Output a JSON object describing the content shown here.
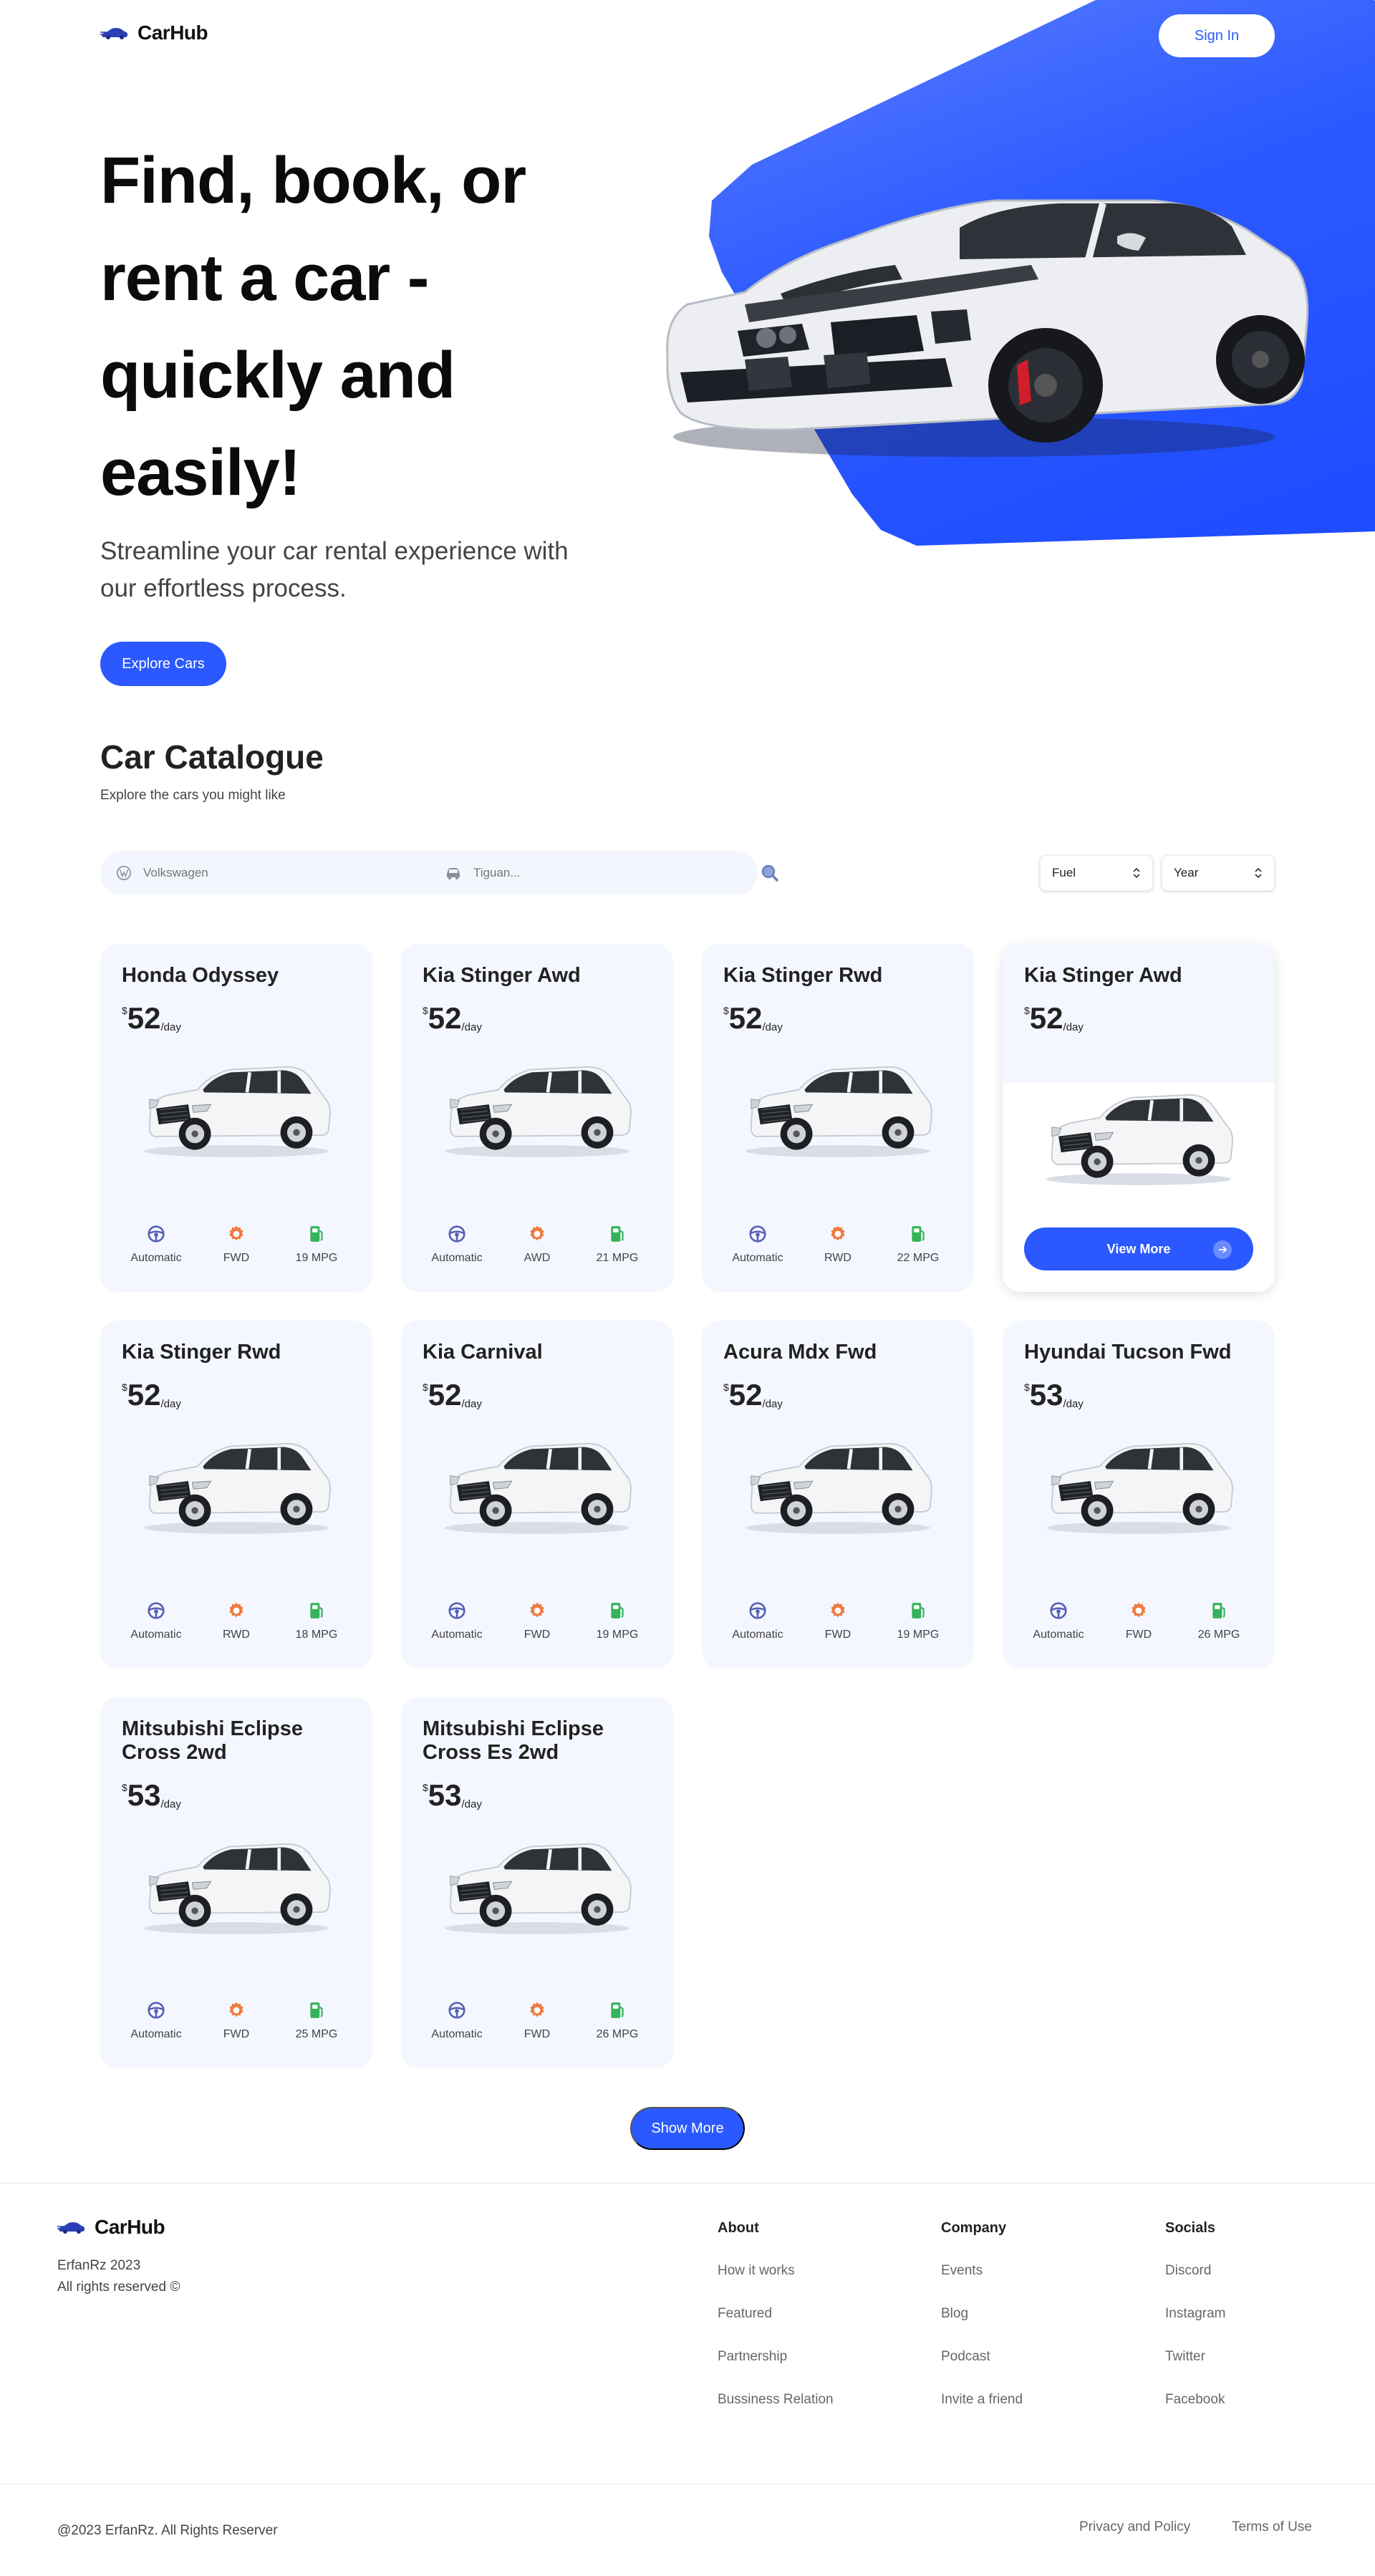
{
  "nav": {
    "logo_text": "CarHub",
    "signin_label": "Sign In"
  },
  "hero": {
    "title": "Find, book, or rent a car - quickly and easily!",
    "subtitle": "Streamline your car rental experience with our effortless process.",
    "cta_label": "Explore Cars"
  },
  "catalogue": {
    "title": "Car Catalogue",
    "subtitle": "Explore the cars you might like",
    "manufacturer_placeholder": "Volkswagen",
    "model_placeholder": "Tiguan...",
    "fuel_label": "Fuel",
    "year_label": "Year"
  },
  "cars": [
    {
      "name": "Honda Odyssey",
      "currency": "$",
      "price": "52",
      "per": "/day",
      "transmission": "Automatic",
      "drive": "FWD",
      "mpg": "19 MPG"
    },
    {
      "name": "Kia Stinger Awd",
      "currency": "$",
      "price": "52",
      "per": "/day",
      "transmission": "Automatic",
      "drive": "AWD",
      "mpg": "21 MPG"
    },
    {
      "name": "Kia Stinger Rwd",
      "currency": "$",
      "price": "52",
      "per": "/day",
      "transmission": "Automatic",
      "drive": "RWD",
      "mpg": "22 MPG"
    },
    {
      "name": "Kia Stinger Awd",
      "currency": "$",
      "price": "52",
      "per": "/day",
      "view_more": "View More"
    },
    {
      "name": "Kia Stinger Rwd",
      "currency": "$",
      "price": "52",
      "per": "/day",
      "transmission": "Automatic",
      "drive": "RWD",
      "mpg": "18 MPG"
    },
    {
      "name": "Kia Carnival",
      "currency": "$",
      "price": "52",
      "per": "/day",
      "transmission": "Automatic",
      "drive": "FWD",
      "mpg": "19 MPG"
    },
    {
      "name": "Acura Mdx Fwd",
      "currency": "$",
      "price": "52",
      "per": "/day",
      "transmission": "Automatic",
      "drive": "FWD",
      "mpg": "19 MPG"
    },
    {
      "name": "Hyundai Tucson Fwd",
      "currency": "$",
      "price": "53",
      "per": "/day",
      "transmission": "Automatic",
      "drive": "FWD",
      "mpg": "26 MPG"
    },
    {
      "name": "Mitsubishi Eclipse Cross 2wd",
      "currency": "$",
      "price": "53",
      "per": "/day",
      "transmission": "Automatic",
      "drive": "FWD",
      "mpg": "25 MPG"
    },
    {
      "name": "Mitsubishi Eclipse Cross Es 2wd",
      "currency": "$",
      "price": "53",
      "per": "/day",
      "transmission": "Automatic",
      "drive": "FWD",
      "mpg": "26 MPG"
    }
  ],
  "show_more_label": "Show More",
  "footer": {
    "logo_text": "CarHub",
    "copyright_line1": "ErfanRz 2023",
    "copyright_line2": "All rights reserved ©",
    "columns": [
      {
        "title": "About",
        "links": [
          "How it works",
          "Featured",
          "Partnership",
          "Bussiness Relation"
        ]
      },
      {
        "title": "Company",
        "links": [
          "Events",
          "Blog",
          "Podcast",
          "Invite a friend"
        ]
      },
      {
        "title": "Socials",
        "links": [
          "Discord",
          "Instagram",
          "Twitter",
          "Facebook"
        ]
      }
    ],
    "bottom_copyright": "@2023 ErfanRz. All Rights Reserver",
    "privacy": "Privacy and Policy",
    "terms": "Terms of Use"
  },
  "colors": {
    "accent": "#2b59ff",
    "card_bg": "#f4f7ff",
    "steering": "#5560b4",
    "gear": "#f07a3c",
    "fuel": "#36b35a"
  }
}
